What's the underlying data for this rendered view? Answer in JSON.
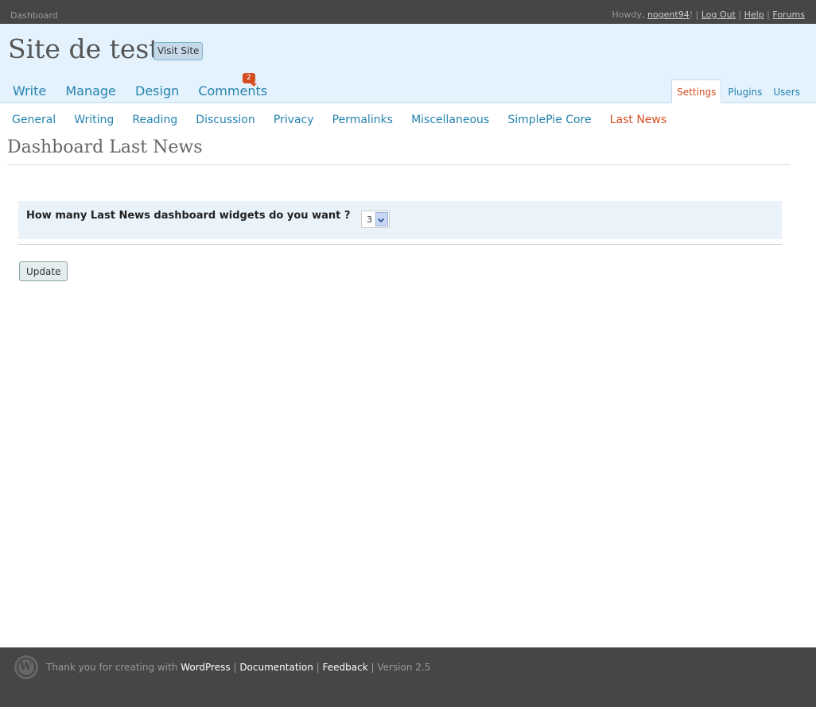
{
  "topbar": {
    "dashboard_label": "Dashboard",
    "howdy": "Howdy, ",
    "username": "nogent94",
    "excl": "!",
    "logout": "Log Out",
    "help": "Help",
    "forums": "Forums",
    "separator": " | "
  },
  "header": {
    "site_title": "Site de test",
    "visit_site": "Visit Site",
    "main_nav": [
      "Write",
      "Manage",
      "Design",
      "Comments"
    ],
    "comment_count": "2",
    "side_nav": [
      {
        "label": "Settings",
        "active": true
      },
      {
        "label": "Plugins",
        "active": false
      },
      {
        "label": "Users",
        "active": false
      }
    ]
  },
  "submenu": [
    "General",
    "Writing",
    "Reading",
    "Discussion",
    "Privacy",
    "Permalinks",
    "Miscellaneous",
    "SimplePie Core",
    "Last News"
  ],
  "submenu_current": "Last News",
  "page": {
    "title": "Dashboard Last News",
    "question": "How many Last News dashboard widgets do you want ?",
    "select_value": "3",
    "update_button": "Update"
  },
  "footer": {
    "thanks": "Thank you for creating with ",
    "wordpress": "WordPress",
    "documentation": "Documentation",
    "feedback": "Feedback",
    "version": "Version 2.5",
    "separator": " | "
  },
  "colors": {
    "link": "#2583ad",
    "accent": "#d54e21",
    "header_bg": "#e4f2fd",
    "bar_bg": "#464646"
  }
}
